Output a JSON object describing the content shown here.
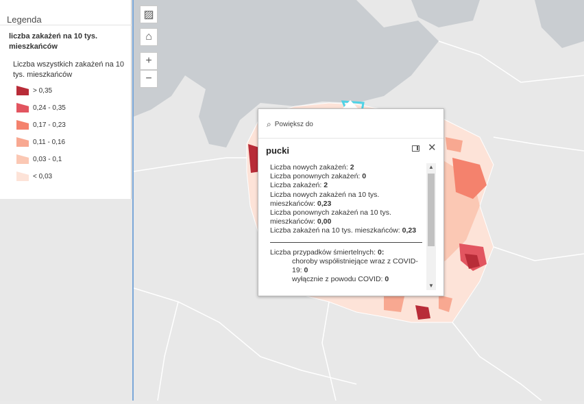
{
  "legend": {
    "title": "Legenda",
    "layer_title": "liczba zakażeń na 10 tys. mieszkańców",
    "field_title": "Liczba wszystkich zakażeń na 10 tys. mieszkańców",
    "classes": [
      {
        "label": "> 0,35",
        "color": "#b82c38"
      },
      {
        "label": "0,24 - 0,35",
        "color": "#e25560"
      },
      {
        "label": "0,17 - 0,23",
        "color": "#f4826d"
      },
      {
        "label": "0,11 - 0,16",
        "color": "#f8a891"
      },
      {
        "label": "0,03 - 0,1",
        "color": "#fbc8b4"
      },
      {
        "label": "< 0,03",
        "color": "#fde3d8"
      }
    ]
  },
  "map_tools": [
    {
      "name": "basemap-gallery-icon",
      "glyph": "▨"
    },
    {
      "name": "home-icon",
      "glyph": "⌂"
    },
    {
      "name": "zoom-in-icon",
      "glyph": "+"
    },
    {
      "name": "zoom-out-icon",
      "glyph": "−"
    }
  ],
  "popup": {
    "zoom_to": "Powiększ do",
    "title": "pucki",
    "lines": [
      {
        "label": "Liczba nowych zakażeń:",
        "value": "2"
      },
      {
        "label": "Liczba ponownych zakażeń:",
        "value": "0"
      },
      {
        "label": "Liczba zakażeń:",
        "value": "2"
      },
      {
        "label": "Liczba nowych zakażeń na 10 tys. mieszkańców:",
        "value": "0,23"
      },
      {
        "label": "Liczba ponownych zakażeń na 10 tys. mieszkańców:",
        "value": "0,00"
      },
      {
        "label": "Liczba zakażeń na 10 tys. mieszkańców:",
        "value": "0,23"
      }
    ],
    "deaths_label": "Liczba przypadków śmiertelnych:",
    "deaths_value": "0:",
    "comorbid_label": "choroby współistniejące wraz z COVID-19:",
    "comorbid_value": "0",
    "covid_only_label": "wyłącznie z powodu COVID:",
    "covid_only_value": "0"
  },
  "colors": {
    "land": "#e8e8e8",
    "sea": "#c9cdd1",
    "border": "#ffffff",
    "selection": "#4fd3e6"
  }
}
